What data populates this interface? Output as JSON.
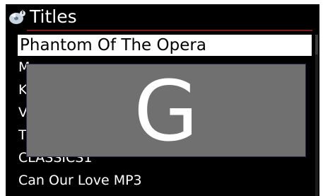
{
  "header": {
    "title": "Titles",
    "icon": "music-disc-icon"
  },
  "list": {
    "items": [
      {
        "label": "Phantom Of The Opera",
        "selected": true
      },
      {
        "label": "M",
        "selected": false
      },
      {
        "label": "K",
        "selected": false
      },
      {
        "label": "V",
        "selected": false
      },
      {
        "label": "T",
        "selected": false
      },
      {
        "label": "CLASSICS1",
        "selected": false
      },
      {
        "label": "Can Our Love MP3",
        "selected": false
      }
    ]
  },
  "overlay": {
    "letter": "G"
  },
  "colors": {
    "background": "#000000",
    "selection": "#ffffff",
    "overlay": "#707070",
    "header_rule": "#7a1a1a"
  }
}
